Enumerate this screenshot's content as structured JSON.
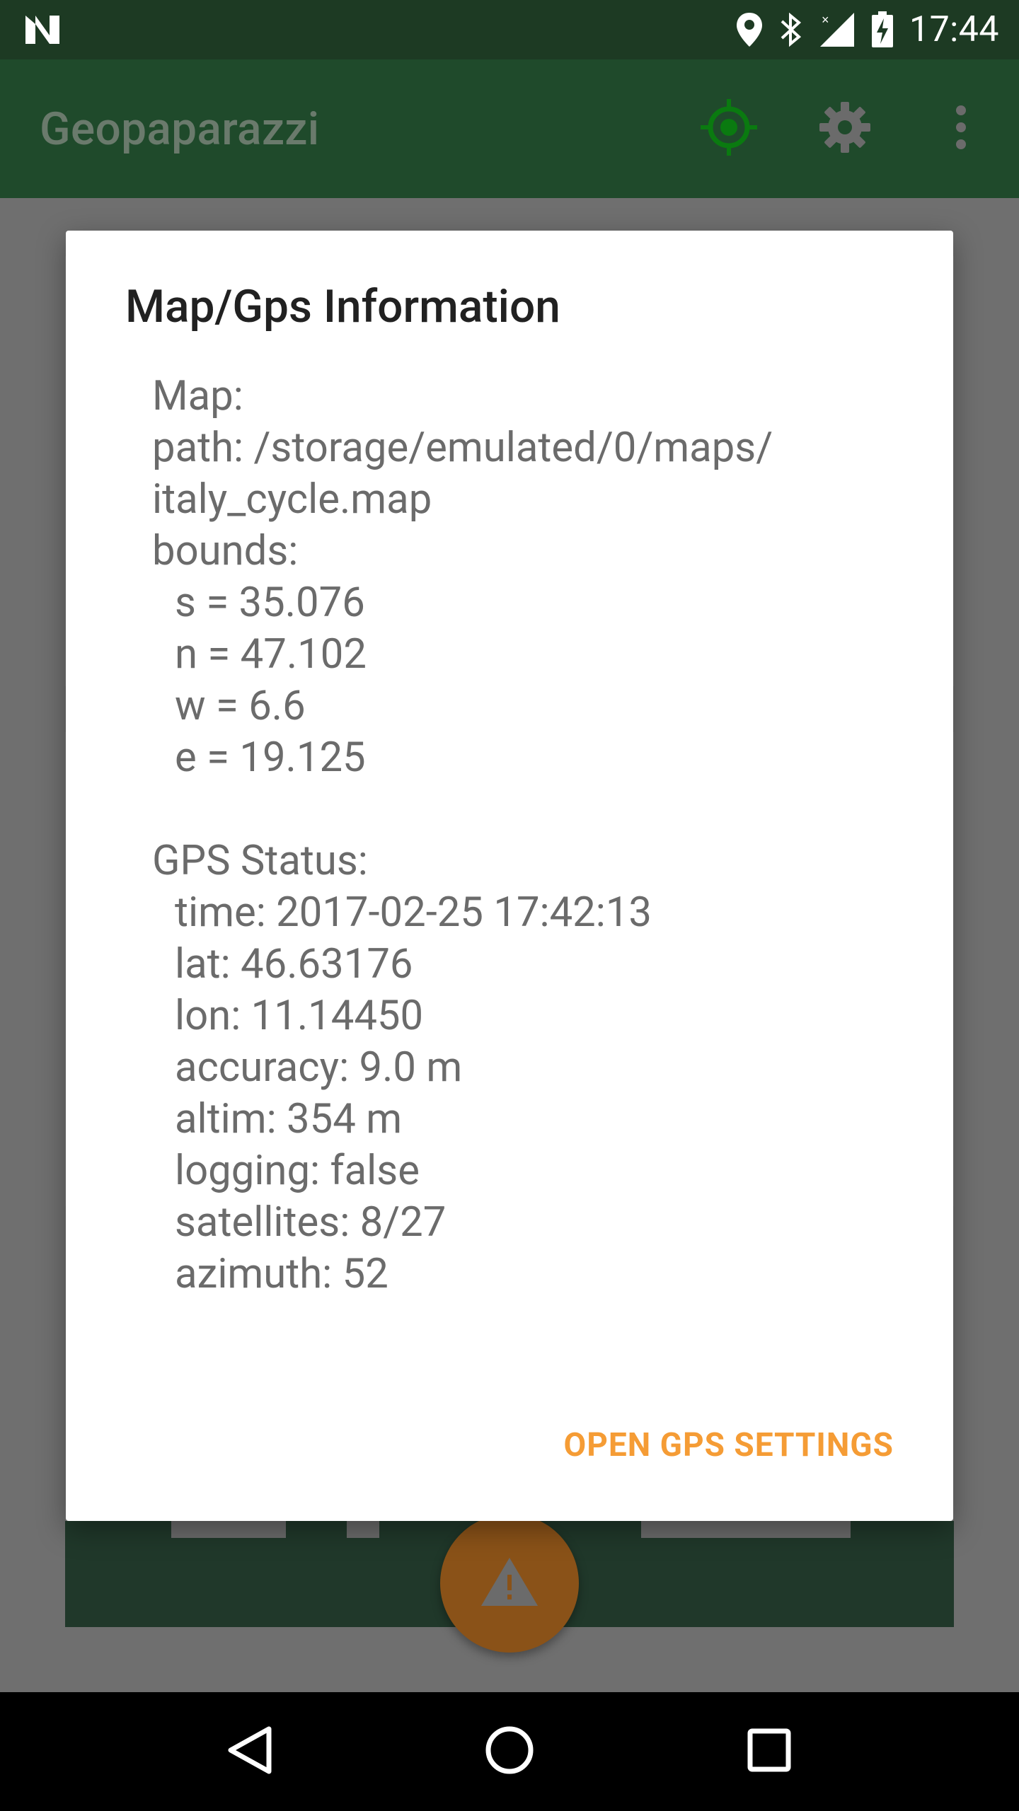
{
  "status_bar": {
    "time": "17:44",
    "icons": [
      "notification-n-icon",
      "location-pin-icon",
      "bluetooth-icon",
      "cellular-signal-icon",
      "battery-charging-icon"
    ]
  },
  "app_bar": {
    "title": "Geopaparazzi",
    "actions": [
      "gps-target-icon",
      "settings-gear-icon",
      "overflow-menu-icon"
    ]
  },
  "dialog": {
    "title": "Map/Gps Information",
    "map": {
      "heading": "Map:",
      "path_lines": [
        "path: /storage/emulated/0/maps/",
        "italy_cycle.map"
      ],
      "bounds_heading": "bounds:",
      "bounds": [
        "s = 35.076",
        "n = 47.102",
        "w = 6.6",
        "e = 19.125"
      ]
    },
    "gps": {
      "heading": "GPS Status:",
      "lines": [
        "time: 2017-02-25 17:42:13",
        "lat: 46.63176",
        "lon: 11.14450",
        "accuracy: 9.0 m",
        "altim: 354 m",
        "logging: false",
        "satellites: 8/27",
        "azimuth: 52"
      ]
    },
    "action_label": "OPEN GPS SETTINGS"
  },
  "colors": {
    "status_bar": "#1d3a23",
    "app_bar": "#1f4a2b",
    "accent": "#f59c35",
    "fab": "#8a5218",
    "gps_icon": "#0a7a10"
  },
  "nav_bar": {
    "buttons": [
      "back-icon",
      "home-icon",
      "recents-icon"
    ]
  }
}
